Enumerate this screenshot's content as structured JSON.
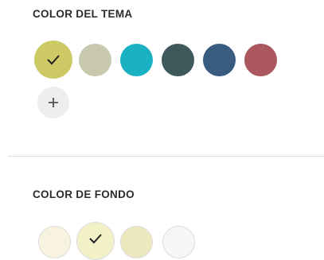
{
  "theme_color": {
    "title": "COLOR DEL TEMA",
    "swatches": [
      {
        "color": "#cdc964",
        "selected": true
      },
      {
        "color": "#c8c9ae",
        "selected": false
      },
      {
        "color": "#1ab2c2",
        "selected": false
      },
      {
        "color": "#3e585c",
        "selected": false
      },
      {
        "color": "#395b80",
        "selected": false
      },
      {
        "color": "#ab575e",
        "selected": false
      }
    ],
    "add_icon": "plus-icon"
  },
  "background_color": {
    "title": "COLOR DE FONDO",
    "swatches": [
      {
        "color": "#f7f3df",
        "selected": false
      },
      {
        "color": "#f2f0c6",
        "selected": true
      },
      {
        "color": "#ede9bf",
        "selected": false
      },
      {
        "color": "#f6f6f6",
        "selected": false
      }
    ]
  },
  "icons": {
    "selected": "check-icon",
    "add": "plus-icon"
  }
}
